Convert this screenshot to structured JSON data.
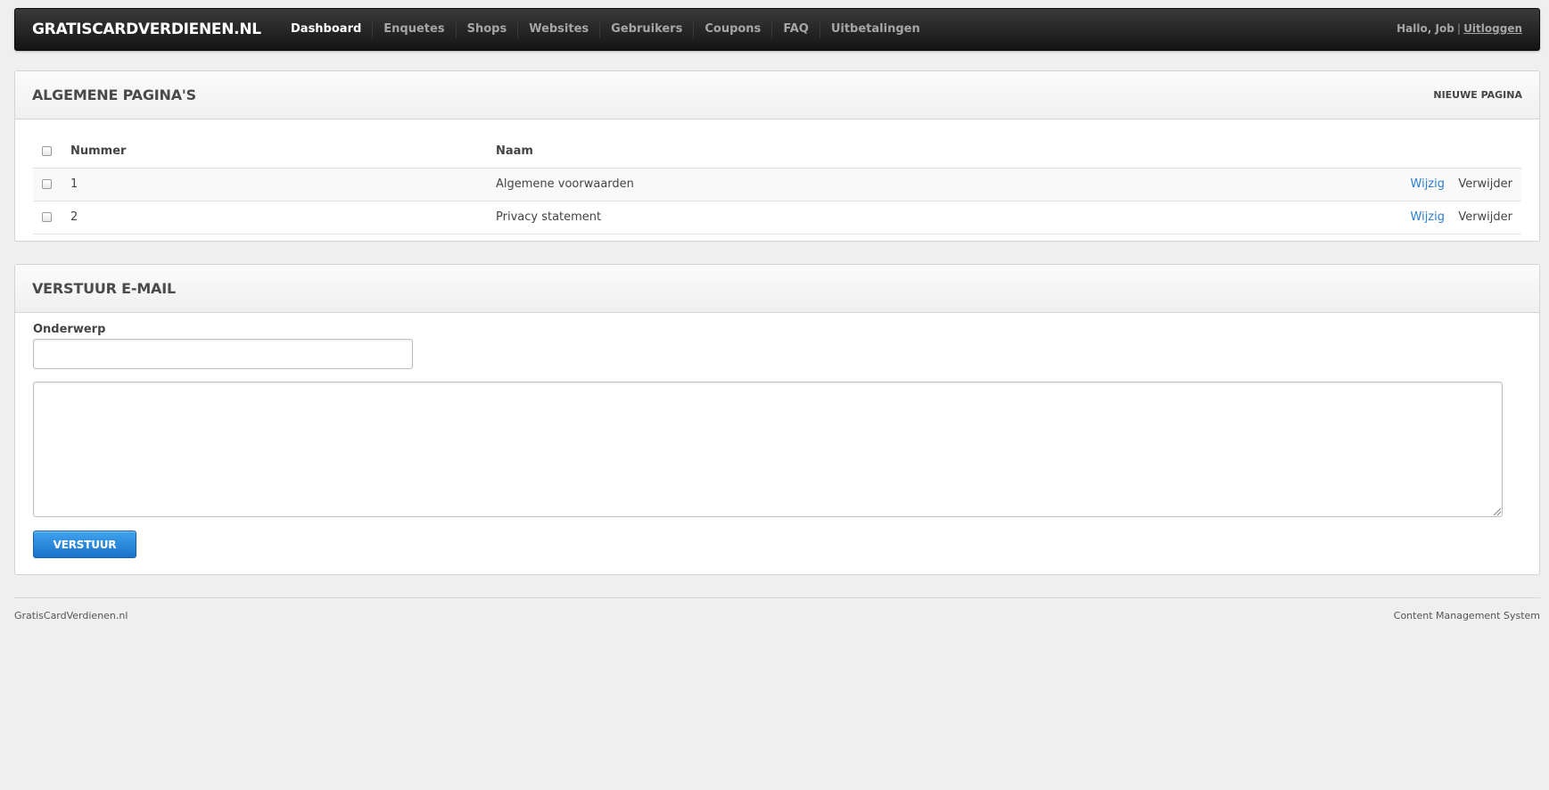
{
  "header": {
    "brand": "GRATISCARDVERDIENEN.NL",
    "nav": [
      {
        "label": "Dashboard",
        "active": true
      },
      {
        "label": "Enquetes",
        "active": false
      },
      {
        "label": "Shops",
        "active": false
      },
      {
        "label": "Websites",
        "active": false
      },
      {
        "label": "Gebruikers",
        "active": false
      },
      {
        "label": "Coupons",
        "active": false
      },
      {
        "label": "FAQ",
        "active": false
      },
      {
        "label": "Uitbetalingen",
        "active": false
      }
    ],
    "greeting": "Hallo, Job",
    "separator": "|",
    "logout": "Uitloggen"
  },
  "pages_panel": {
    "title": "ALGEMENE PAGINA'S",
    "new_page_label": "NIEUWE PAGINA",
    "columns": {
      "number": "Nummer",
      "name": "Naam"
    },
    "rows": [
      {
        "number": "1",
        "name": "Algemene voorwaarden",
        "edit": "Wijzig",
        "delete": "Verwijder"
      },
      {
        "number": "2",
        "name": "Privacy statement",
        "edit": "Wijzig",
        "delete": "Verwijder"
      }
    ]
  },
  "email_panel": {
    "title": "VERSTUUR E-MAIL",
    "subject_label": "Onderwerp",
    "subject_value": "",
    "body_value": "",
    "send_label": "VERSTUUR"
  },
  "footer": {
    "left": "GratisCardVerdienen.nl",
    "right": "Content Management System"
  },
  "colors": {
    "accent": "#2a7fcf",
    "button": "#1a73c9",
    "topbar": "#1a1a1a"
  }
}
